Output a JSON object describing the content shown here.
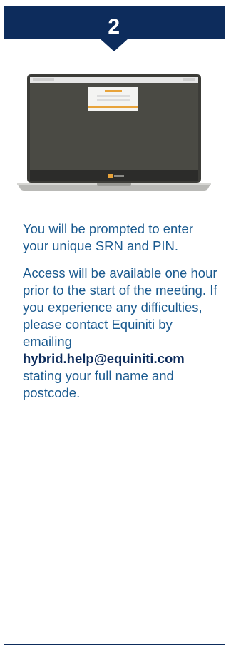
{
  "step": {
    "number": "2"
  },
  "colors": {
    "header_bg": "#0d2c5c",
    "text": "#1a5a8f",
    "link": "#0d2c5c",
    "laptop_screen": "#4a4a44",
    "accent": "#e8a33a"
  },
  "illustration": {
    "icon": "laptop-login-screen-icon"
  },
  "instructions": {
    "paragraph_1": "You will be prompted to enter your unique SRN and PIN.",
    "paragraph_2_intro": "Access will be available one hour prior to the start of the meeting. If you experience any difficulties, please contact Equiniti by emailing",
    "contact_email": "hybrid.help@equiniti.com",
    "paragraph_2_outro": "stating your full name and postcode."
  }
}
